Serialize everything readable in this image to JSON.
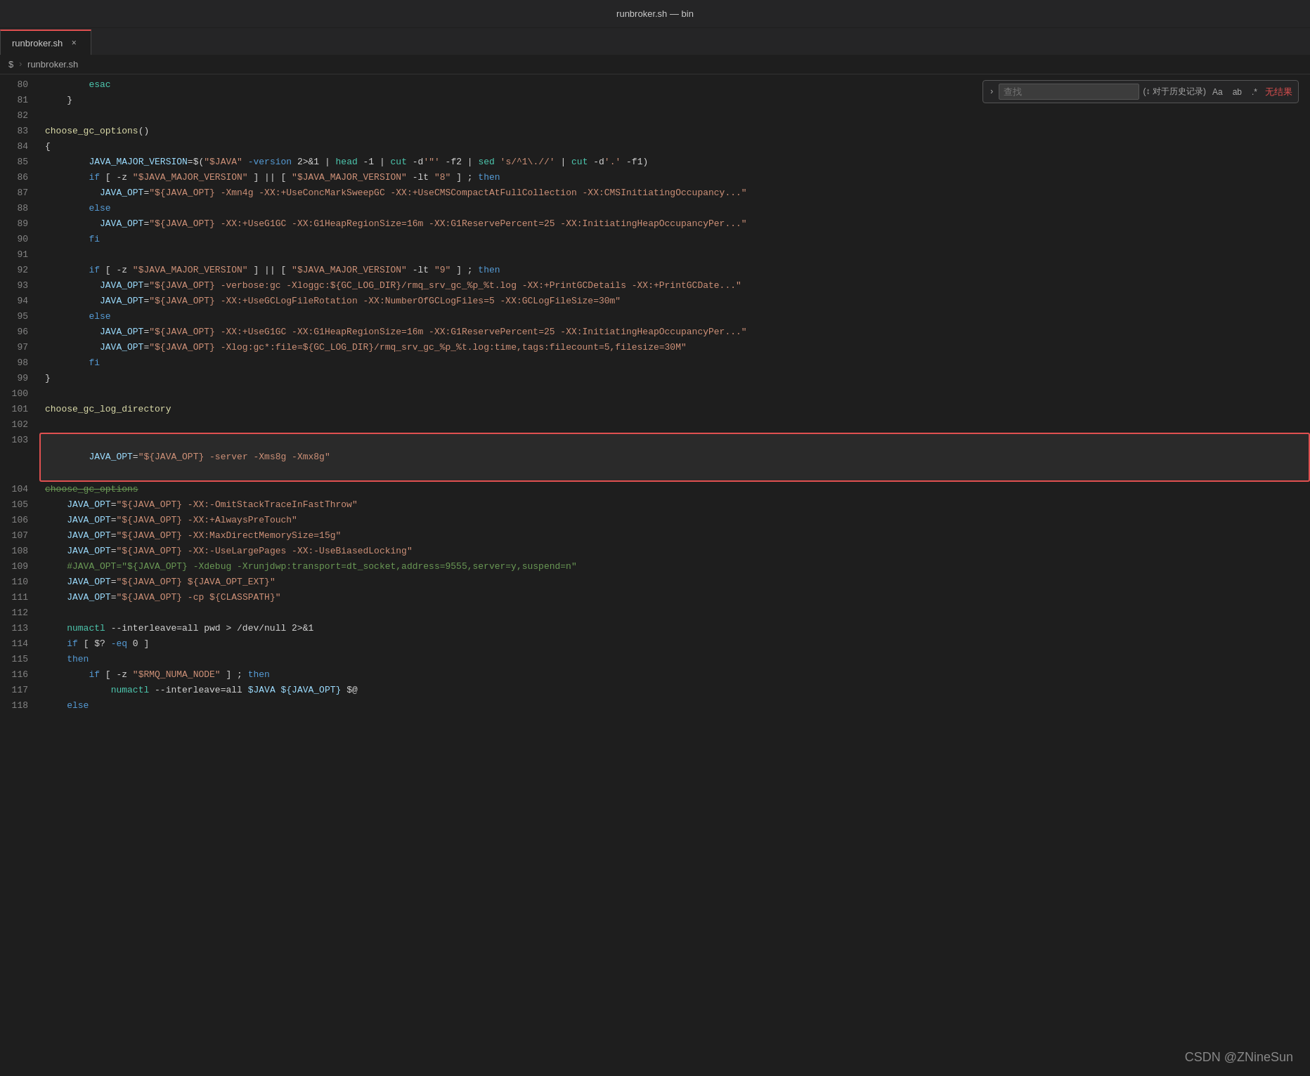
{
  "titleBar": {
    "title": "runbroker.sh — bin"
  },
  "tab": {
    "filename": "runbroker.sh",
    "close": "×"
  },
  "breadcrumb": {
    "parts": [
      "$",
      "runbroker.sh"
    ]
  },
  "search": {
    "placeholder": "查找",
    "hint": "(↕ 对于历史记录)",
    "optAa": "Aa",
    "optAb": "ab",
    "optRegex": ".*",
    "noResult": "无结果"
  },
  "watermark": "CSDN @ZNineSun",
  "lines": [
    {
      "num": "80",
      "content": "esac",
      "indent": 2
    },
    {
      "num": "81",
      "content": "}",
      "indent": 1
    },
    {
      "num": "82",
      "content": ""
    },
    {
      "num": "83",
      "content": "choose_gc_options()"
    },
    {
      "num": "84",
      "content": "{"
    },
    {
      "num": "85",
      "content": "    JAVA_MAJOR_VERSION=$(\"$JAVA\" -version 2>&1 | head -1 | cut -d'\"' -f2 | sed 's/^1\\.//' | cut -d'.' -f1)"
    },
    {
      "num": "86",
      "content": "    if [ -z \"$JAVA_MAJOR_VERSION\" ] || [ \"$JAVA_MAJOR_VERSION\" -lt \"8\" ] ; then"
    },
    {
      "num": "87",
      "content": "      JAVA_OPT=\"${JAVA_OPT} -Xmn4g -XX:+UseConcMarkSweepGC -XX:+UseCMSCompactAtFullCollection -XX:CMSInitiatingOccupancy..."
    },
    {
      "num": "88",
      "content": "    else"
    },
    {
      "num": "89",
      "content": "      JAVA_OPT=\"${JAVA_OPT} -XX:+UseG1GC -XX:G1HeapRegionSize=16m -XX:G1ReservePercent=25 -XX:InitiatingHeapOccupancyPer..."
    },
    {
      "num": "90",
      "content": "    fi"
    },
    {
      "num": "91",
      "content": ""
    },
    {
      "num": "92",
      "content": "    if [ -z \"$JAVA_MAJOR_VERSION\" ] || [ \"$JAVA_MAJOR_VERSION\" -lt \"9\" ] ; then"
    },
    {
      "num": "93",
      "content": "      JAVA_OPT=\"${JAVA_OPT} -verbose:gc -Xloggc:${GC_LOG_DIR}/rmq_srv_gc_%p_%t.log -XX:+PrintGCDetails -XX:+PrintGCDate..."
    },
    {
      "num": "94",
      "content": "      JAVA_OPT=\"${JAVA_OPT} -XX:+UseGCLogFileRotation -XX:NumberOfGCLogFiles=5 -XX:GCLogFileSize=30m\""
    },
    {
      "num": "95",
      "content": "    else"
    },
    {
      "num": "96",
      "content": "      JAVA_OPT=\"${JAVA_OPT} -XX:+UseG1GC -XX:G1HeapRegionSize=16m -XX:G1ReservePercent=25 -XX:InitiatingHeapOccupancyPer..."
    },
    {
      "num": "97",
      "content": "      JAVA_OPT=\"${JAVA_OPT} -Xlog:gc*:file=${GC_LOG_DIR}/rmq_srv_gc_%p_%t.log:time,tags:filecount=5,filesize=30M\""
    },
    {
      "num": "98",
      "content": "    fi"
    },
    {
      "num": "99",
      "content": "}"
    },
    {
      "num": "100",
      "content": ""
    },
    {
      "num": "101",
      "content": "choose_gc_log_directory"
    },
    {
      "num": "102",
      "content": ""
    },
    {
      "num": "103",
      "content": "JAVA_OPT=\"${JAVA_OPT} -server -Xms8g -Xmx8g\"",
      "highlight": true
    },
    {
      "num": "104",
      "content": "choose_gc_options",
      "strikethrough": true
    },
    {
      "num": "105",
      "content": "    JAVA_OPT=\"${JAVA_OPT} -XX:-OmitStackTraceInFastThrow\""
    },
    {
      "num": "106",
      "content": "    JAVA_OPT=\"${JAVA_OPT} -XX:+AlwaysPreTouch\""
    },
    {
      "num": "107",
      "content": "    JAVA_OPT=\"${JAVA_OPT} -XX:MaxDirectMemorySize=15g\""
    },
    {
      "num": "108",
      "content": "    JAVA_OPT=\"${JAVA_OPT} -XX:-UseLargePages -XX:-UseBiasedLocking\""
    },
    {
      "num": "109",
      "content": "    #JAVA_OPT=\"${JAVA_OPT} -Xdebug -Xrunjdwp:transport=dt_socket,address=9555,server=y,suspend=n\"",
      "comment": true
    },
    {
      "num": "110",
      "content": "    JAVA_OPT=\"${JAVA_OPT} ${JAVA_OPT_EXT}\""
    },
    {
      "num": "111",
      "content": "    JAVA_OPT=\"${JAVA_OPT} -cp ${CLASSPATH}\""
    },
    {
      "num": "112",
      "content": ""
    },
    {
      "num": "113",
      "content": "    numactl --interleave=all pwd > /dev/null 2>&1"
    },
    {
      "num": "114",
      "content": "    if [ $? -eq 0 ]"
    },
    {
      "num": "115",
      "content": "    then"
    },
    {
      "num": "116",
      "content": "        if [ -z \"$RMQ_NUMA_NODE\" ] ; then"
    },
    {
      "num": "117",
      "content": "            numactl --interleave=all $JAVA ${JAVA_OPT} $@"
    },
    {
      "num": "118",
      "content": "    else"
    }
  ]
}
